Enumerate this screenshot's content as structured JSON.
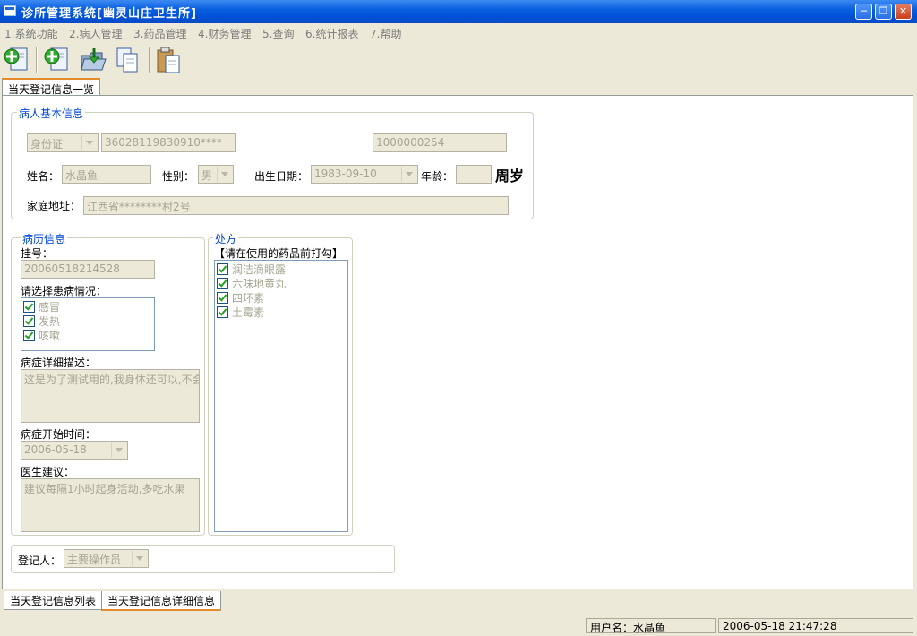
{
  "window": {
    "title": "诊所管理系统[幽灵山庄卫生所]"
  },
  "menu": [
    {
      "num": "1.",
      "label": "系统功能"
    },
    {
      "num": "2.",
      "label": "病人管理"
    },
    {
      "num": "3.",
      "label": "药品管理"
    },
    {
      "num": "4.",
      "label": "财务管理"
    },
    {
      "num": "5.",
      "label": "查询"
    },
    {
      "num": "6.",
      "label": "统计报表"
    },
    {
      "num": "7.",
      "label": "帮助"
    }
  ],
  "top_tab": "当天登记信息一览",
  "basic_info": {
    "legend": "病人基本信息",
    "id_type": "身份证",
    "id_number": "36028119830910****",
    "record_no": "1000000254",
    "name_label": "姓名：",
    "name": "水晶鱼",
    "gender_label": "性别：",
    "gender": "男",
    "dob_label": "出生日期：",
    "dob": "1983-09-10",
    "age_label": "年龄：",
    "age": "",
    "age_unit": "周岁",
    "address_label": "家庭地址：",
    "address": "江西省********村2号"
  },
  "history": {
    "legend": "病历信息",
    "reg_label": "挂号：",
    "reg_no": "20060518214528",
    "condition_label": "请选择患病情况：",
    "conditions": [
      "感冒",
      "发热",
      "咳嗽"
    ],
    "desc_label": "病症详细描述：",
    "desc": "这是为了测试用的,我身体还可以,不会",
    "start_label": "病症开始时间：",
    "start_date": "2006-05-18",
    "advice_label": "医生建议：",
    "advice": "建议每隔1小时起身活动,多吃水果"
  },
  "prescription": {
    "legend": "处方",
    "hint": "【请在使用的药品前打勾】",
    "drugs": [
      "润洁滴眼露",
      "六味地黄丸",
      "四环素",
      "土霉素"
    ]
  },
  "registrar": {
    "label": "登记人：",
    "value": "主要操作员"
  },
  "bottom_tabs": [
    "当天登记信息列表",
    "当天登记信息详细信息"
  ],
  "status": {
    "user": "用户名：水晶鱼",
    "datetime": "2006-05-18  21:47:28"
  },
  "colors": {
    "accent": "#0046d5",
    "titlebar": "#0a5fe0",
    "icon_green": "#21a121"
  }
}
